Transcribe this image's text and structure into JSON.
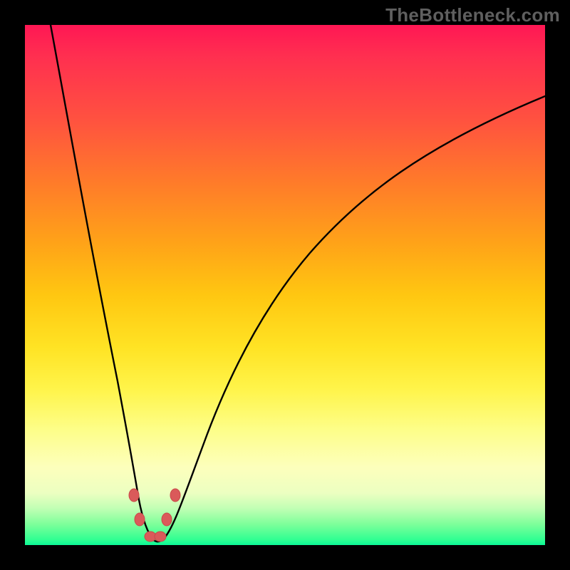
{
  "watermark": "TheBottleneck.com",
  "chart_data": {
    "type": "line",
    "title": "",
    "xlabel": "",
    "ylabel": "",
    "xlim": [
      0,
      100
    ],
    "ylim": [
      0,
      100
    ],
    "x": [
      5,
      8,
      12,
      15,
      18,
      20,
      21,
      22,
      23,
      24,
      25,
      26,
      28,
      30,
      34,
      40,
      48,
      56,
      64,
      74,
      86,
      100
    ],
    "values": [
      100,
      80,
      56,
      40,
      24,
      13,
      9,
      4,
      1,
      0,
      0,
      1,
      4,
      9,
      22,
      37,
      51,
      60,
      67,
      74,
      80,
      86
    ],
    "markers": {
      "x": [
        20.5,
        21.5,
        26.5,
        27.5,
        24,
        25
      ],
      "y": [
        9,
        4,
        4,
        9,
        1.5,
        1.5
      ]
    },
    "colors": {
      "gradient_top": "#ff1754",
      "gradient_mid": "#ffe324",
      "gradient_bottom": "#0cf796",
      "curve": "#000000",
      "marker": "#da5a5a"
    }
  }
}
